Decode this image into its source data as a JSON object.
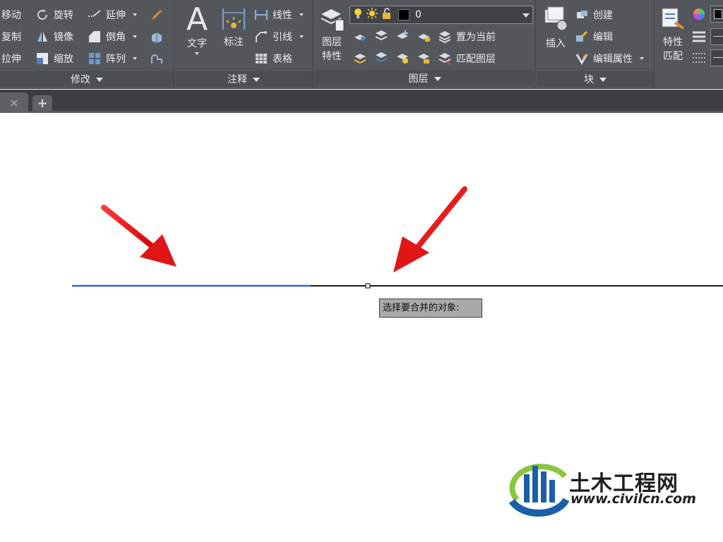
{
  "ribbon": {
    "modify": {
      "title": "修改",
      "tools": {
        "move": "移动",
        "rotate": "旋转",
        "extend": "延伸",
        "copy": "复制",
        "mirror": "镜像",
        "chamfer": "倒角",
        "stretch": "拉伸",
        "scale": "缩放",
        "array": "阵列"
      }
    },
    "annotation": {
      "title": "注释",
      "tools": {
        "text": "文字",
        "dimension": "标注",
        "linear": "线性",
        "leader": "引线",
        "table": "表格"
      }
    },
    "layers": {
      "title": "图层",
      "layer_properties": [
        "图层",
        "特性"
      ],
      "current_layer_value": "0",
      "set_current": "置为当前",
      "match_layer": "匹配图层"
    },
    "block": {
      "title": "块",
      "insert": "插入",
      "create": "创建",
      "edit": "编辑",
      "edit_attributes": "编辑属性"
    },
    "properties": {
      "match_properties": [
        "特性",
        "匹配"
      ]
    }
  },
  "tabs": {
    "close_glyph": "×",
    "add_glyph": "+"
  },
  "canvas": {
    "prompt_tooltip": "选择要合并的对象:",
    "line_selected_color": "#3b64c8",
    "line_color": "#1e1e1e",
    "arrow_color": "#e01515"
  },
  "watermark": {
    "name": "土木工程网",
    "url": "www.civilcn.com"
  }
}
